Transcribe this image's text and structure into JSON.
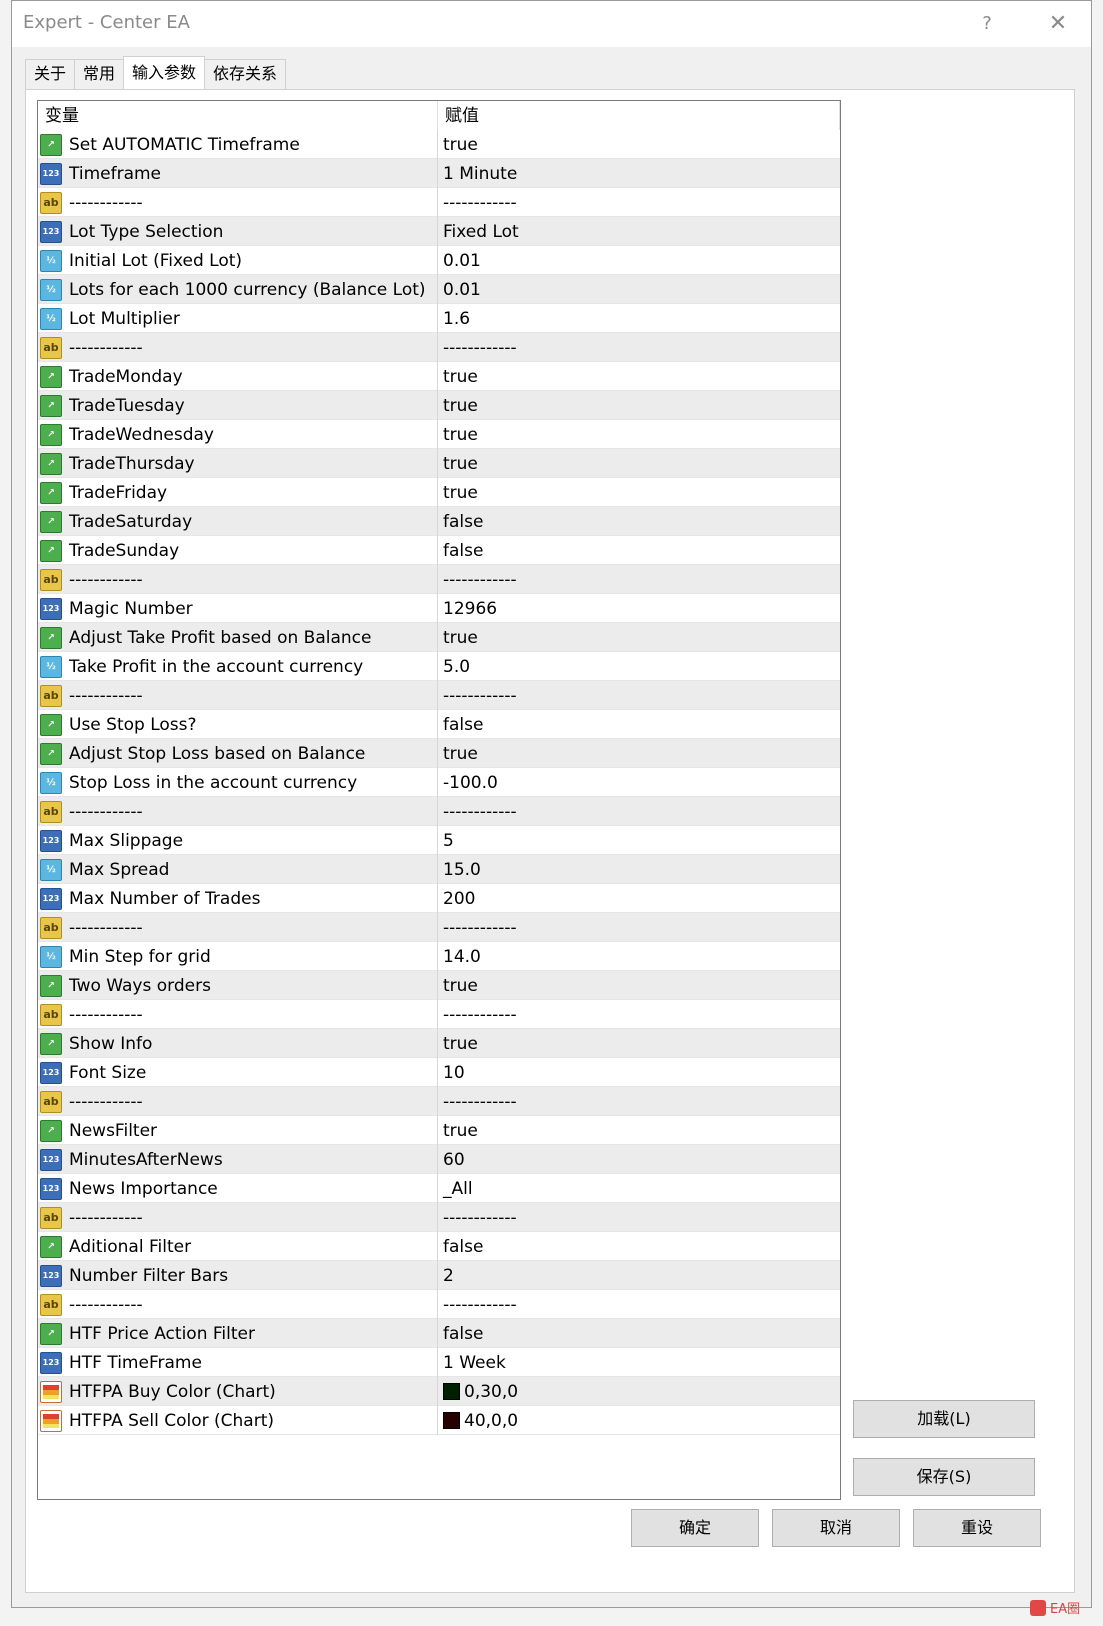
{
  "window": {
    "title": "Expert - Center EA",
    "help": "?",
    "close": "✕"
  },
  "tabs": [
    {
      "label": "关于"
    },
    {
      "label": "常用"
    },
    {
      "label": "输入参数"
    },
    {
      "label": "依存关系"
    }
  ],
  "grid": {
    "columns": {
      "name": "变量",
      "value": "赋值"
    },
    "rows": [
      {
        "type": "bool",
        "name": "Set AUTOMATIC Timeframe",
        "value": "true"
      },
      {
        "type": "int",
        "name": "Timeframe",
        "value": "1 Minute"
      },
      {
        "type": "str",
        "name": "------------",
        "value": "------------"
      },
      {
        "type": "int",
        "name": "Lot Type Selection",
        "value": "Fixed Lot"
      },
      {
        "type": "dbl",
        "name": "Initial Lot (Fixed Lot)",
        "value": "0.01"
      },
      {
        "type": "dbl",
        "name": "Lots for each 1000 currency (Balance Lot)",
        "value": "0.01"
      },
      {
        "type": "dbl",
        "name": "Lot Multiplier",
        "value": "1.6"
      },
      {
        "type": "str",
        "name": "------------",
        "value": "------------"
      },
      {
        "type": "bool",
        "name": "TradeMonday",
        "value": "true"
      },
      {
        "type": "bool",
        "name": "TradeTuesday",
        "value": "true"
      },
      {
        "type": "bool",
        "name": "TradeWednesday",
        "value": "true"
      },
      {
        "type": "bool",
        "name": "TradeThursday",
        "value": "true"
      },
      {
        "type": "bool",
        "name": "TradeFriday",
        "value": "true"
      },
      {
        "type": "bool",
        "name": "TradeSaturday",
        "value": "false"
      },
      {
        "type": "bool",
        "name": "TradeSunday",
        "value": "false"
      },
      {
        "type": "str",
        "name": "------------",
        "value": "------------"
      },
      {
        "type": "int",
        "name": "Magic Number",
        "value": "12966"
      },
      {
        "type": "bool",
        "name": "Adjust Take Profit based on Balance",
        "value": "true"
      },
      {
        "type": "dbl",
        "name": "Take Profit in the account currency",
        "value": "5.0"
      },
      {
        "type": "str",
        "name": "------------",
        "value": "------------"
      },
      {
        "type": "bool",
        "name": "Use Stop Loss?",
        "value": "false"
      },
      {
        "type": "bool",
        "name": "Adjust Stop Loss based on Balance",
        "value": "true"
      },
      {
        "type": "dbl",
        "name": "Stop Loss in the account currency",
        "value": "-100.0"
      },
      {
        "type": "str",
        "name": "------------",
        "value": "------------"
      },
      {
        "type": "int",
        "name": "Max Slippage",
        "value": "5"
      },
      {
        "type": "dbl",
        "name": "Max Spread",
        "value": "15.0"
      },
      {
        "type": "int",
        "name": "Max Number of Trades",
        "value": "200"
      },
      {
        "type": "str",
        "name": "------------",
        "value": "------------"
      },
      {
        "type": "dbl",
        "name": "Min Step for grid",
        "value": "14.0"
      },
      {
        "type": "bool",
        "name": "Two Ways orders",
        "value": "true"
      },
      {
        "type": "str",
        "name": "------------",
        "value": "------------"
      },
      {
        "type": "bool",
        "name": "Show Info",
        "value": "true"
      },
      {
        "type": "int",
        "name": "Font Size",
        "value": "10"
      },
      {
        "type": "str",
        "name": "------------",
        "value": "------------"
      },
      {
        "type": "bool",
        "name": "NewsFilter",
        "value": "true"
      },
      {
        "type": "int",
        "name": "MinutesAfterNews",
        "value": "60"
      },
      {
        "type": "int",
        "name": "News Importance",
        "value": "_All"
      },
      {
        "type": "str",
        "name": "------------",
        "value": "------------"
      },
      {
        "type": "bool",
        "name": "Aditional Filter",
        "value": "false"
      },
      {
        "type": "int",
        "name": "Number Filter Bars",
        "value": "2"
      },
      {
        "type": "str",
        "name": "------------",
        "value": "------------"
      },
      {
        "type": "bool",
        "name": "HTF Price Action Filter",
        "value": "false"
      },
      {
        "type": "int",
        "name": "HTF TimeFrame",
        "value": "1 Week"
      },
      {
        "type": "clr",
        "name": "HTFPA Buy Color (Chart)",
        "value": "0,30,0",
        "swatch": "#001e00"
      },
      {
        "type": "clr",
        "name": "HTFPA Sell Color (Chart)",
        "value": "40,0,0",
        "swatch": "#280000"
      }
    ]
  },
  "icons": {
    "bool": {
      "name": "bool-type-icon",
      "glyph": "↗"
    },
    "int": {
      "name": "integer-type-icon",
      "glyph": "123"
    },
    "dbl": {
      "name": "double-type-icon",
      "glyph": "½"
    },
    "str": {
      "name": "string-type-icon",
      "glyph": "ab"
    },
    "clr": {
      "name": "color-type-icon",
      "glyph": ""
    }
  },
  "buttons": {
    "load": "加载(L)",
    "save": "保存(S)",
    "ok": "确定",
    "cancel": "取消",
    "reset": "重设"
  },
  "watermark": "EA圈"
}
